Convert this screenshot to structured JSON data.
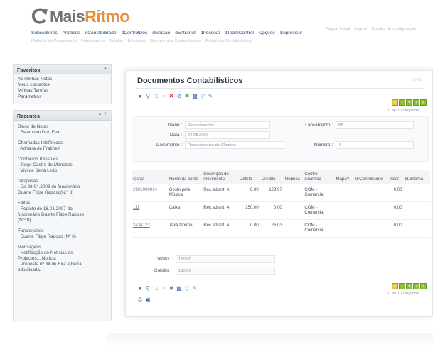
{
  "logo": {
    "text_main": "Mais",
    "text_accent": "Ritmo"
  },
  "topnav": [
    "Subscritores",
    "Análises",
    "dContabilidade",
    "dControlDoc",
    "dGestão",
    "dEntranet",
    "dPessoal",
    "dTeamControl",
    "Opções",
    "Supervisor"
  ],
  "subnav": [
    "Modelos de Pensamento",
    "Funcionários",
    "Tabelas",
    "Entidades",
    "Documentos Contabilísticos",
    "Relatórios Contabilísticos"
  ],
  "toplinks": [
    "Página Inicial",
    "Logout",
    "Opções de configuração"
  ],
  "favoritos": {
    "title": "Favoritos",
    "items": [
      "As minhas Notas",
      "Meus contactos",
      "Minhas Tarefas",
      "Parâmetros"
    ]
  },
  "recentes": {
    "title": "Recentes",
    "groups": [
      {
        "title": "Bloco de Notas",
        "lines": [
          ". Falar com Dra. Eva"
        ]
      },
      {
        "title": "Chamadas telefónicas",
        "lines": [
          ". Adriana de Fratinell"
        ]
      },
      {
        "title": "Contactos Pessoais",
        "lines": [
          ". Jorge Castro de Menezes",
          ". Vivi de Sena Leão"
        ]
      },
      {
        "title": "Despesas",
        "lines": [
          ". De 26.04.2008 do funcionário",
          "Duarte Filipe Raposo(N.º 8)"
        ]
      },
      {
        "title": "Faltas",
        "lines": [
          ". Registo de 16.01.2007 do",
          "funcionário Duarte Filipe Raposo",
          "(N.º 8)"
        ]
      },
      {
        "title": "Funcionários",
        "lines": [
          ". Duarte Filipe Raposo (Nº 8)"
        ]
      },
      {
        "title": "Mensagens",
        "lines": [
          ". Notificação de Notícias de",
          "Projectos....Notícia",
          ". Proposta nº 34 de Eira e Beira",
          "adjudicada."
        ]
      }
    ]
  },
  "panel": {
    "title": "Documentos Contabilísticos",
    "faded_right": "Voltar",
    "records": "10 de 100 registos.",
    "records_bottom": "10 de 100 registos."
  },
  "form": {
    "diario_label": "Diário :",
    "diario_value": "Recebimentos",
    "data_label": "Data :",
    "data_value": "24.08.2007",
    "documento_label": "Documento :",
    "documento_value": "Recebimentos de Clientes",
    "lancamento_label": "Lançamento :",
    "lancamento_value": "88",
    "numero_label": "Número :",
    "numero_value": "4"
  },
  "table": {
    "headers": [
      "Conta",
      "Nome da conta",
      "Descrição do movimento",
      "Débito",
      "Crédito",
      "Rúbrica",
      "Centro Analítico",
      "Mapa?",
      "NºContribuinte",
      "Valor",
      "Id.Interna"
    ],
    "rows": [
      {
        "conta": "2691000014",
        "nome": "Gosto pela Música",
        "descricao": "Rec.adiant. 4",
        "debito": "0.00",
        "credito": "123.97",
        "rubrica": "",
        "centro": "COM - Comercial",
        "mapa": "",
        "contribuinte": "",
        "valor": "0.00",
        "interna": ""
      },
      {
        "conta": "111",
        "nome": "Caixa",
        "descricao": "Rec.adiant. 4",
        "debito": "150.00",
        "credito": "0.00",
        "rubrica": "",
        "centro": "COM - Comercial",
        "mapa": "",
        "contribuinte": "",
        "valor": "0.00",
        "interna": ""
      },
      {
        "conta": "2434123",
        "nome": "Taxa Normal",
        "descricao": "Rec.adiant. 4",
        "debito": "0.00",
        "credito": "26.03",
        "rubrica": "",
        "centro": "COM - Comercial",
        "mapa": "",
        "contribuinte": "",
        "valor": "0.00",
        "interna": ""
      }
    ]
  },
  "totals": {
    "debito_label": "Débito :",
    "debito_value": "150.00",
    "credito_label": "Crédito :",
    "credito_value": "150.00"
  },
  "colors": {
    "accent": "#e8913a",
    "nav_green": "#8cbf3a",
    "link_blue": "#2d4d7a"
  }
}
